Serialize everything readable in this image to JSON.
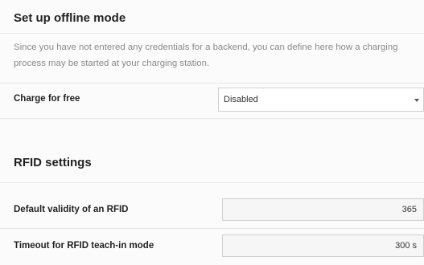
{
  "offline": {
    "title": "Set up offline mode",
    "description": "Since you have not entered any credentials for a backend, you can define here how a charging process may be started at your charging station.",
    "charge_for_free": {
      "label": "Charge for free",
      "value": "Disabled",
      "icon": "chevron-down-icon"
    }
  },
  "rfid": {
    "title": "RFID settings",
    "default_validity": {
      "label": "Default validity of an RFID",
      "value": "365"
    },
    "teach_in_timeout": {
      "label": "Timeout for RFID teach-in mode",
      "value": "300 s"
    }
  }
}
